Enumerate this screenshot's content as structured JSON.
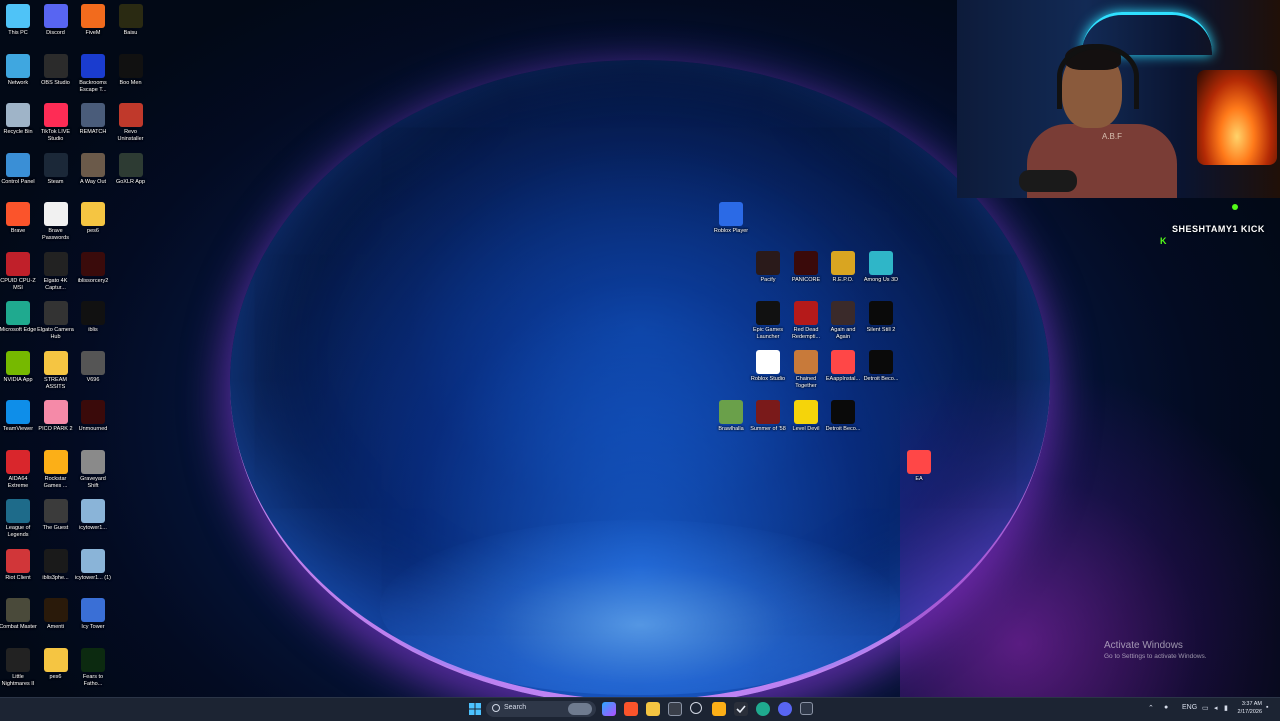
{
  "desktop": {
    "left_icons": [
      {
        "label": "This PC",
        "icon": "this-pc-icon",
        "color": "#4fc3f7"
      },
      {
        "label": "Discord",
        "icon": "discord-icon",
        "color": "#5865f2"
      },
      {
        "label": "FiveM",
        "icon": "fivem-icon",
        "color": "#f26b1d"
      },
      {
        "label": "Baisu",
        "icon": "baisu-icon",
        "color": "#2a2a12"
      },
      {
        "label": "Network",
        "icon": "network-icon",
        "color": "#3fa7e0"
      },
      {
        "label": "OBS Studio",
        "icon": "obs-icon",
        "color": "#2b2b2b"
      },
      {
        "label": "Backrooms Escape T...",
        "icon": "backrooms-icon",
        "color": "#1a3ccf"
      },
      {
        "label": "Boo Men",
        "icon": "boo-men-icon",
        "color": "#111111"
      },
      {
        "label": "Recycle Bin",
        "icon": "recycle-bin-icon",
        "color": "#9fb4c8"
      },
      {
        "label": "TikTok LIVE Studio",
        "icon": "tiktok-icon",
        "color": "#fe2c55"
      },
      {
        "label": "REMATCH",
        "icon": "rematch-icon",
        "color": "#4a5c7a"
      },
      {
        "label": "Revo Uninstaller",
        "icon": "revo-icon",
        "color": "#c0392b"
      },
      {
        "label": "Control Panel",
        "icon": "control-panel-icon",
        "color": "#3a8fd6"
      },
      {
        "label": "Steam",
        "icon": "steam-icon",
        "color": "#1b2838"
      },
      {
        "label": "A Way Out",
        "icon": "a-way-out-icon",
        "color": "#6b5a4a"
      },
      {
        "label": "GoXLR App",
        "icon": "goxlr-icon",
        "color": "#2d3b33"
      },
      {
        "label": "Brave",
        "icon": "brave-icon",
        "color": "#fb542b"
      },
      {
        "label": "Brave Passwords",
        "icon": "document-icon",
        "color": "#f1f1f1"
      },
      {
        "label": "pes6",
        "icon": "folder-icon",
        "color": "#f5c542"
      },
      {
        "label": "",
        "icon": "empty",
        "color": ""
      },
      {
        "label": "CPUID CPU-Z MSI",
        "icon": "cpuz-icon",
        "color": "#c0202a"
      },
      {
        "label": "Elgato 4K Captur...",
        "icon": "elgato-4k-icon",
        "color": "#222222"
      },
      {
        "label": "iblissorcery2",
        "icon": "ibliss-icon",
        "color": "#3a0b0b"
      },
      {
        "label": "",
        "icon": "empty",
        "color": ""
      },
      {
        "label": "Microsoft Edge",
        "icon": "edge-icon",
        "color": "#1faa8f"
      },
      {
        "label": "Elgato Camera Hub",
        "icon": "camera-hub-icon",
        "color": "#333333"
      },
      {
        "label": "iblis",
        "icon": "iblis-icon",
        "color": "#111111"
      },
      {
        "label": "",
        "icon": "empty",
        "color": ""
      },
      {
        "label": "NVIDIA App",
        "icon": "nvidia-icon",
        "color": "#76b900"
      },
      {
        "label": "STREAM ASSITS",
        "icon": "folder-icon",
        "color": "#f5c542"
      },
      {
        "label": "V696",
        "icon": "v696-icon",
        "color": "#555555"
      },
      {
        "label": "",
        "icon": "empty",
        "color": ""
      },
      {
        "label": "TeamViewer",
        "icon": "teamviewer-icon",
        "color": "#0e8ee9"
      },
      {
        "label": "PICO PARK 2",
        "icon": "pico-park-icon",
        "color": "#f58aa8"
      },
      {
        "label": "Unmourned",
        "icon": "unmourned-icon",
        "color": "#3a0a0a"
      },
      {
        "label": "",
        "icon": "empty",
        "color": ""
      },
      {
        "label": "AIDA64 Extreme",
        "icon": "aida64-icon",
        "color": "#d9262c"
      },
      {
        "label": "Rockstar Games ...",
        "icon": "rockstar-icon",
        "color": "#fcaf17"
      },
      {
        "label": "Graveyard Shift",
        "icon": "graveyard-icon",
        "color": "#8a8a8a"
      },
      {
        "label": "",
        "icon": "empty",
        "color": ""
      },
      {
        "label": "League of Legends",
        "icon": "league-icon",
        "color": "#1e6b8a"
      },
      {
        "label": "The Guest",
        "icon": "the-guest-icon",
        "color": "#3b3b3b"
      },
      {
        "label": "icytower1...",
        "icon": "icytower-icon",
        "color": "#8ab4d8"
      },
      {
        "label": "",
        "icon": "empty",
        "color": ""
      },
      {
        "label": "Riot Client",
        "icon": "riot-icon",
        "color": "#d13639"
      },
      {
        "label": "iblis3phe...",
        "icon": "iblis3-icon",
        "color": "#1a1a1a"
      },
      {
        "label": "icytower1... (1)",
        "icon": "icytower-icon",
        "color": "#8ab4d8"
      },
      {
        "label": "",
        "icon": "empty",
        "color": ""
      },
      {
        "label": "Combat Master",
        "icon": "combat-master-icon",
        "color": "#4a4a3a"
      },
      {
        "label": "Amenti",
        "icon": "amenti-icon",
        "color": "#2a1a0a"
      },
      {
        "label": "Icy Tower",
        "icon": "icy-tower-icon",
        "color": "#3a6fd6"
      },
      {
        "label": "",
        "icon": "empty",
        "color": ""
      },
      {
        "label": "Little Nightmares II",
        "icon": "little-nightmares-icon",
        "color": "#222222"
      },
      {
        "label": "pes6",
        "icon": "folder-icon",
        "color": "#f5c542"
      },
      {
        "label": "Fears to Fatho...",
        "icon": "fears-icon",
        "color": "#0c2a10"
      },
      {
        "label": "",
        "icon": "empty",
        "color": ""
      }
    ],
    "right_icons": [
      {
        "label": "Roblox Player",
        "icon": "roblox-player-icon",
        "color": "#2b6ae6"
      },
      {
        "label": "Pacify",
        "icon": "pacify-icon",
        "color": "#2a1a1a"
      },
      {
        "label": "PANICORE",
        "icon": "panicore-icon",
        "color": "#3a0a0a"
      },
      {
        "label": "R.E.P.O.",
        "icon": "repo-icon",
        "color": "#d9a521"
      },
      {
        "label": "Among Us 3D",
        "icon": "among-us-icon",
        "color": "#2fb6c8"
      },
      {
        "label": "Epic Games Launcher",
        "icon": "epic-icon",
        "color": "#111111"
      },
      {
        "label": "Red Dead Redempti...",
        "icon": "red-dead-icon",
        "color": "#b51a1a"
      },
      {
        "label": "Again and Again",
        "icon": "again-icon",
        "color": "#3a2a2a"
      },
      {
        "label": "Silent Still 2",
        "icon": "silent-still-icon",
        "color": "#0a0a0a"
      },
      {
        "label": "Roblox Studio",
        "icon": "roblox-studio-icon",
        "color": "#ffffff"
      },
      {
        "label": "Chained Together",
        "icon": "chained-icon",
        "color": "#c87a3a"
      },
      {
        "label": "EAappInstal...",
        "icon": "ea-app-icon",
        "color": "#ff4747"
      },
      {
        "label": "Detroit Beco...",
        "icon": "detroit-icon",
        "color": "#0a0a0a"
      },
      {
        "label": "Brawlhalla",
        "icon": "brawlhalla-icon",
        "color": "#6aa04a"
      },
      {
        "label": "Summer of '58",
        "icon": "summer-58-icon",
        "color": "#7a1a1a"
      },
      {
        "label": "Level Devil",
        "icon": "level-devil-icon",
        "color": "#f5d40a"
      },
      {
        "label": "Detroit Beco...",
        "icon": "detroit-icon",
        "color": "#0a0a0a"
      },
      {
        "label": "EA",
        "icon": "ea-icon",
        "color": "#ff4747"
      }
    ]
  },
  "webcam": {
    "shirt_text": "A.B.F",
    "neon_color": "#2fe0ff"
  },
  "stream_overlay": {
    "username": "SHESHTAMY1",
    "platform": "KICK",
    "k_glyph": "K",
    "accent": "#53fc18"
  },
  "watermark": {
    "title": "Activate Windows",
    "subtitle": "Go to Settings to activate Windows."
  },
  "taskbar": {
    "search_label": "Search",
    "apps": [
      "windows-start-icon",
      "file-explorer-icon",
      "copilot-icon",
      "brave-icon",
      "folder-icon",
      "store-icon",
      "rockstar-icon",
      "chatgpt-icon",
      "capcut-icon",
      "edge-icon",
      "discord-icon",
      "settings-icon"
    ],
    "language": "ENG",
    "time": "3:37 AM",
    "date": "2/17/2026"
  }
}
